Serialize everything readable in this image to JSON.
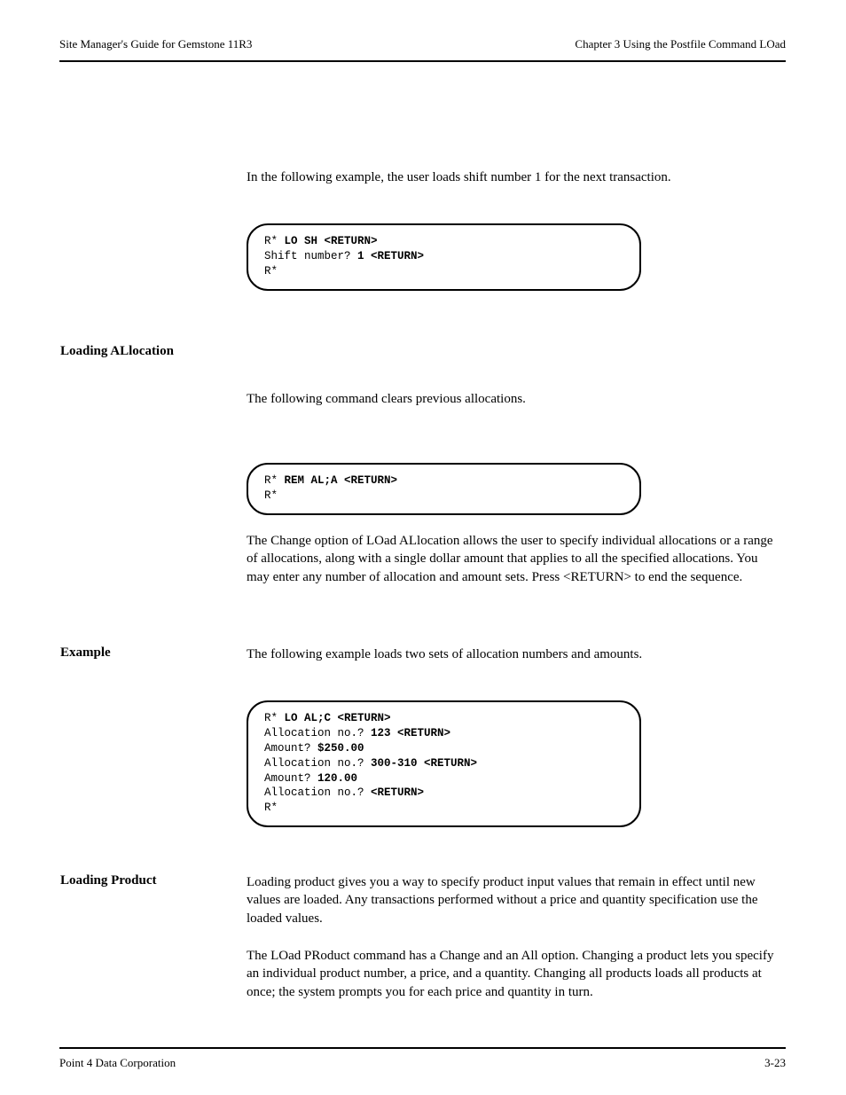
{
  "header": {
    "left": "Site Manager's Guide for Gemstone 11R3",
    "right": "Chapter 3  Using the Postfile Command LOad"
  },
  "footer": {
    "left": "Point 4 Data Corporation",
    "right": "3-23"
  },
  "intro_para": "In the following example, the user loads shift number 1 for the next transaction.",
  "term1": {
    "l1a": "R* ",
    "l1b": "LO SH <RETURN>",
    "l2a": "Shift number? ",
    "l2b": "1 <RETURN>",
    "l3": "R*"
  },
  "section_allocation_heading": "Loading ALlocation",
  "para_allocation": "The following command clears previous allocations.",
  "term2": {
    "l1a": "R* ",
    "l1b": "REM AL;A <RETURN>",
    "l2": "R*"
  },
  "para_allocation_after": "The Change option of LOad ALlocation allows the user to specify individual allocations or a range of allocations, along with a single dollar amount that applies to all the specified allocations. You may enter any number of allocation and amount sets. Press <RETURN> to end the sequence.",
  "example_label": "Example",
  "example_intro": "The following example loads two sets of allocation numbers and amounts.",
  "term3": {
    "l1a": "R* ",
    "l1b": "LO AL;C <RETURN>",
    "l2a": "Allocation no.? ",
    "l2b": "123 <RETURN>",
    "l3a": "Amount? ",
    "l3b": "$250.00",
    "l4a": "Allocation no.? ",
    "l4b": "300-310 <RETURN>",
    "l5a": "Amount? ",
    "l5b": "120.00",
    "l6a": "Allocation no.? ",
    "l6b": "<RETURN>",
    "l7": "R*"
  },
  "section_prod_heading": "Loading Product",
  "para_prod_1": "Loading product gives you a way to specify product input values that remain in effect until new values are loaded. Any transactions performed without a price and quantity specification use the loaded values.",
  "para_prod_2": "The LOad PRoduct command has a Change and an All option. Changing a product lets you specify an individual product number, a price, and a quantity. Changing all products loads all products at once; the system prompts you for each price and quantity in turn."
}
